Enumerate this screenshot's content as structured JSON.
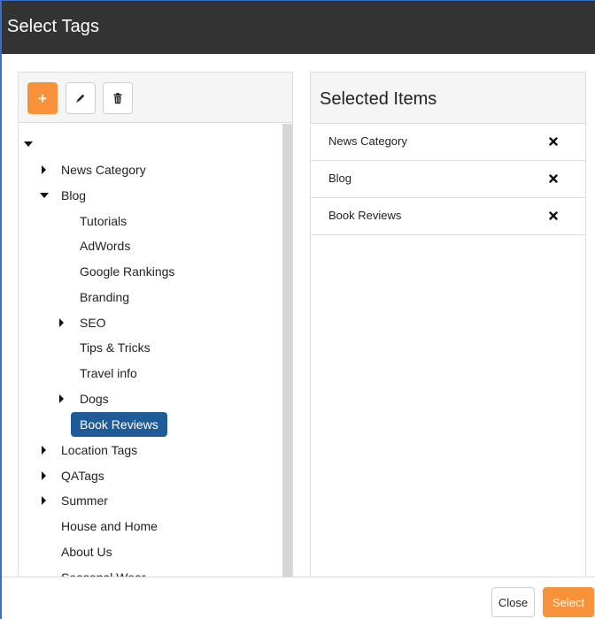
{
  "modal": {
    "title": "Select Tags"
  },
  "toolbar": {
    "add_icon": "plus-icon",
    "edit_icon": "pencil-icon",
    "delete_icon": "trash-icon"
  },
  "tree": {
    "nodes": [
      {
        "label": "",
        "caret": "down",
        "depth": 0
      },
      {
        "label": "News Category",
        "caret": "right",
        "depth": 1
      },
      {
        "label": "Blog",
        "caret": "down",
        "depth": 1
      },
      {
        "label": "Tutorials",
        "caret": "none",
        "depth": 2
      },
      {
        "label": "AdWords",
        "caret": "none",
        "depth": 2
      },
      {
        "label": "Google Rankings",
        "caret": "none",
        "depth": 2
      },
      {
        "label": "Branding",
        "caret": "none",
        "depth": 2
      },
      {
        "label": "SEO",
        "caret": "right",
        "depth": 2
      },
      {
        "label": "Tips & Tricks",
        "caret": "none",
        "depth": 2
      },
      {
        "label": "Travel info",
        "caret": "none",
        "depth": 2
      },
      {
        "label": "Dogs",
        "caret": "right",
        "depth": 2
      },
      {
        "label": "Book Reviews",
        "caret": "none",
        "depth": 2,
        "selected": true
      },
      {
        "label": "Location Tags",
        "caret": "right",
        "depth": 1
      },
      {
        "label": "QATags",
        "caret": "right",
        "depth": 1
      },
      {
        "label": "Summer",
        "caret": "right",
        "depth": 1
      },
      {
        "label": "House and Home",
        "caret": "none",
        "depth": 1
      },
      {
        "label": "About Us",
        "caret": "none",
        "depth": 1
      },
      {
        "label": "Seasonal Wear",
        "caret": "none",
        "depth": 1
      }
    ]
  },
  "selected_panel": {
    "title": "Selected Items",
    "items": [
      {
        "label": "News Category"
      },
      {
        "label": "Blog"
      },
      {
        "label": "Book Reviews"
      }
    ],
    "remove_icon": "close-x-icon"
  },
  "footer": {
    "close_label": "Close",
    "select_label": "Select"
  },
  "colors": {
    "header_bg": "#333333",
    "accent_orange": "#f7913a",
    "selected_node_bg": "#1f5c97",
    "border_blue": "#3b6fbf"
  }
}
